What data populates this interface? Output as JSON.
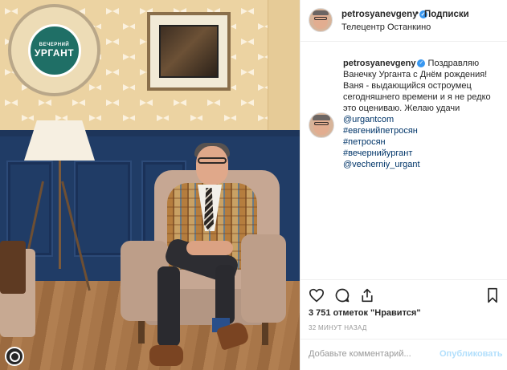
{
  "photo": {
    "logo_line1": "ВЕЧЕРНИЙ",
    "logo_line2": "УРГАНТ"
  },
  "header": {
    "username": "petrosyanevgeny",
    "dot": "•",
    "follow_label": "Подписки",
    "location": "Телецентр Останкино"
  },
  "caption": {
    "username": "petrosyanevgeny",
    "text": "Поздравляю Ванечку Урганта с Днём рождения! Ваня - выдающийся остроумец сегодняшнего времени и я не редко это оцениваю. Желаю удачи",
    "tags": [
      "@urgantcom",
      "#евгенийпетросян",
      "#петросян",
      "#вечернийургант",
      "@vecherniy_urgant"
    ]
  },
  "actions": {
    "like_icon": "heart-icon",
    "comment_icon": "comment-icon",
    "share_icon": "share-icon",
    "save_icon": "bookmark-icon"
  },
  "likes": "3 751 отметок \"Нравится\"",
  "time": "32 МИНУТ НАЗАД",
  "comment": {
    "placeholder": "Добавьте комментарий...",
    "post_label": "Опубликовать"
  },
  "colors": {
    "verified": "#3897f0",
    "tag_link": "#003569",
    "post_disabled": "#b2dffc"
  }
}
